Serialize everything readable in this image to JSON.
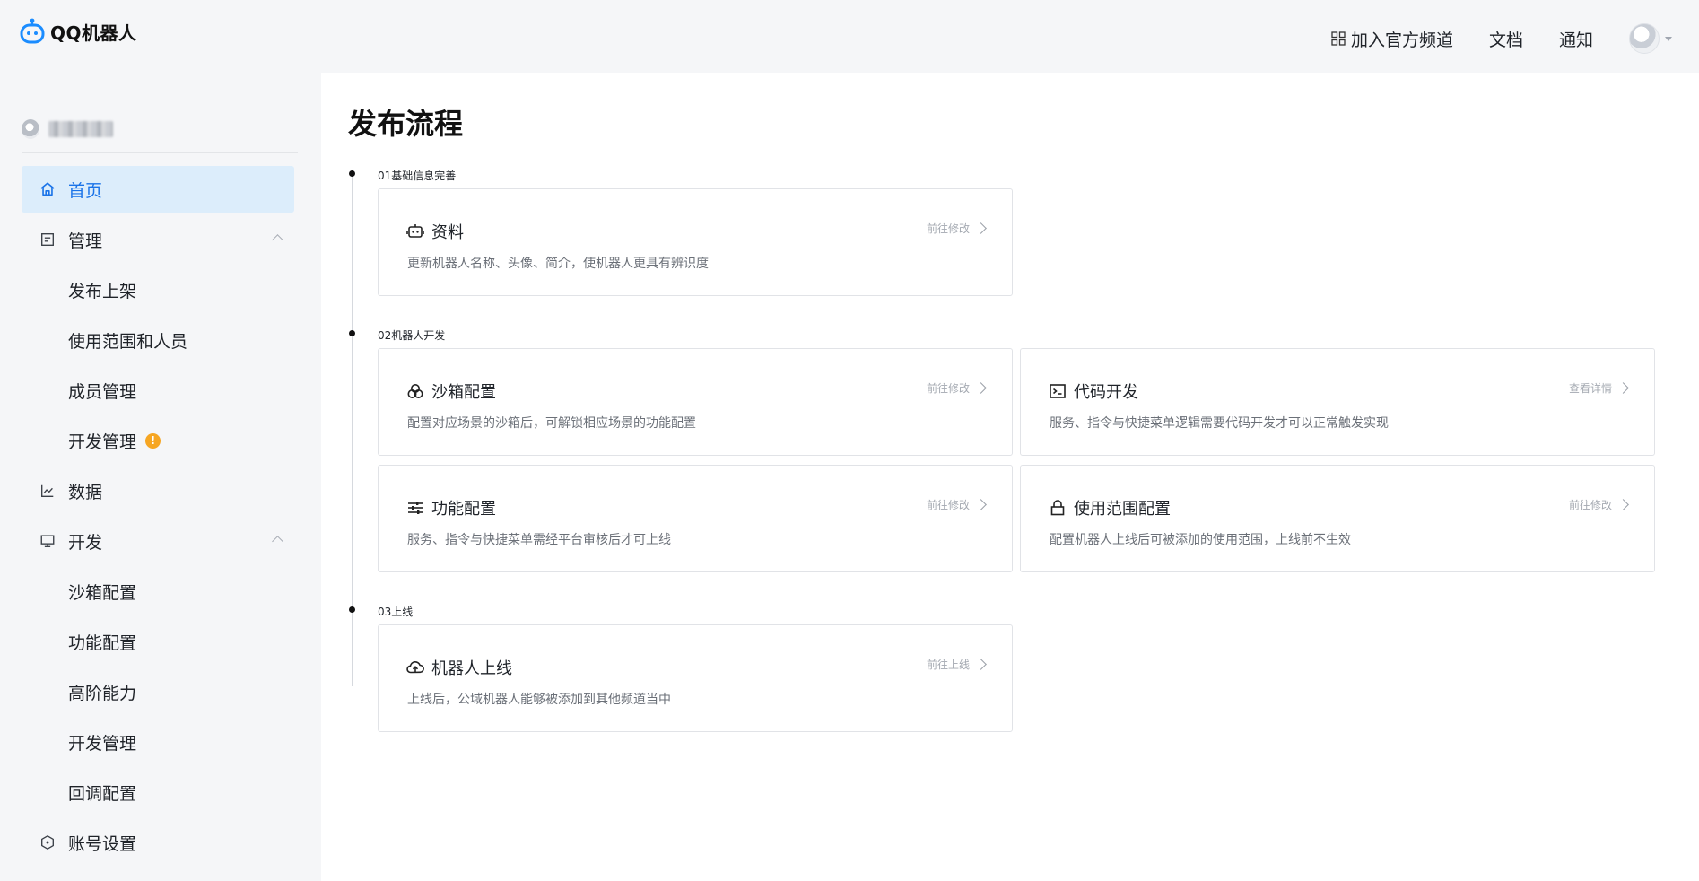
{
  "header": {
    "logo_text": "QQ机器人",
    "links": {
      "channel": "加入官方频道",
      "docs": "文档",
      "notify": "通知"
    }
  },
  "sidebar": {
    "items": [
      {
        "label": "首页",
        "icon": "home-icon",
        "active": true
      },
      {
        "label": "管理",
        "icon": "document-icon",
        "expanded": true
      },
      {
        "label": "发布上架"
      },
      {
        "label": "使用范围和人员"
      },
      {
        "label": "成员管理"
      },
      {
        "label": "开发管理",
        "badge": "!"
      },
      {
        "label": "数据",
        "icon": "chart-icon"
      },
      {
        "label": "开发",
        "icon": "monitor-icon",
        "expanded": true
      },
      {
        "label": "沙箱配置"
      },
      {
        "label": "功能配置"
      },
      {
        "label": "高阶能力"
      },
      {
        "label": "开发管理"
      },
      {
        "label": "回调配置"
      },
      {
        "label": "账号设置",
        "icon": "hexagon-icon"
      }
    ]
  },
  "main": {
    "title": "发布流程",
    "sections": [
      {
        "label": "01基础信息完善"
      },
      {
        "label": "02机器人开发"
      },
      {
        "label": "03上线"
      }
    ],
    "cards": {
      "profile": {
        "title": "资料",
        "desc": "更新机器人名称、头像、简介，使机器人更具有辨识度",
        "action": "前往修改",
        "icon": "robot-icon"
      },
      "sandbox": {
        "title": "沙箱配置",
        "desc": "配置对应场景的沙箱后，可解锁相应场景的功能配置",
        "action": "前往修改",
        "icon": "circles-icon"
      },
      "code": {
        "title": "代码开发",
        "desc": "服务、指令与快捷菜单逻辑需要代码开发才可以正常触发实现",
        "action": "查看详情",
        "icon": "terminal-icon"
      },
      "feature": {
        "title": "功能配置",
        "desc": "服务、指令与快捷菜单需经平台审核后才可上线",
        "action": "前往修改",
        "icon": "sliders-icon"
      },
      "scope": {
        "title": "使用范围配置",
        "desc": "配置机器人上线后可被添加的使用范围，上线前不生效",
        "action": "前往修改",
        "icon": "lock-icon"
      },
      "launch": {
        "title": "机器人上线",
        "desc": "上线后，公域机器人能够被添加到其他频道当中",
        "action": "前往上线",
        "icon": "cloud-upload-icon"
      }
    }
  }
}
